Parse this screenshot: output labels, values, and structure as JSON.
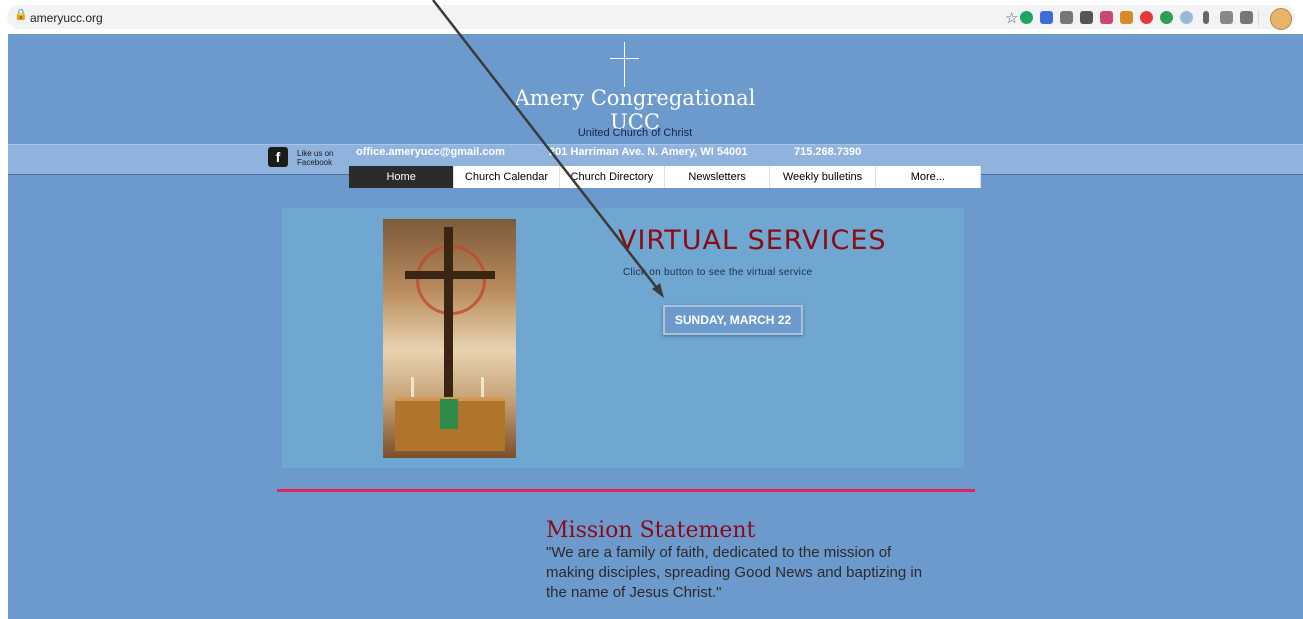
{
  "browser": {
    "url": "ameryucc.org"
  },
  "site": {
    "title": "Amery Congregational UCC",
    "subtitle": "United Church of Christ",
    "facebook_label": "Like us on Facebook",
    "email": "office.ameryucc@gmail.com",
    "address": "201 Harriman Ave. N. Amery, WI 54001",
    "phone": "715.268.7390"
  },
  "nav": {
    "items": [
      {
        "label": "Home",
        "active": true
      },
      {
        "label": "Church Calendar"
      },
      {
        "label": "Church Directory"
      },
      {
        "label": "Newsletters"
      },
      {
        "label": "Weekly bulletins"
      },
      {
        "label": "More..."
      }
    ]
  },
  "hero": {
    "heading": "VIRTUAL SERVICES",
    "instruction": "Click on button to see the virtual service",
    "button_label": "SUNDAY, MARCH 22"
  },
  "mission": {
    "heading": "Mission Statement",
    "text": "\"We are a family of faith, dedicated to the mission of making disciples, spreading Good News and baptizing in the name of Jesus Christ.\""
  },
  "colors": {
    "site_bg": "#6d9acd",
    "hero_bg": "#6fa7d0",
    "heading_red": "#8b0b14",
    "divider": "#e0245e"
  }
}
